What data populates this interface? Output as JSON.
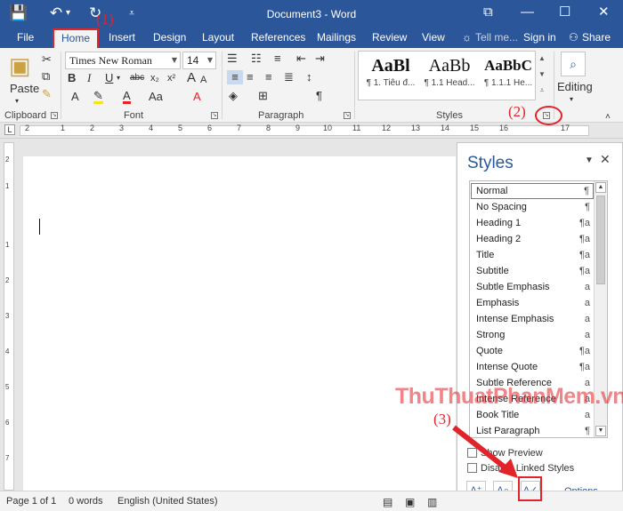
{
  "window": {
    "title": "Document3 - Word",
    "qat": {
      "save_icon": "💾",
      "undo_icon": "↶",
      "redo_icon": "↻",
      "customize_icon": "⩾"
    },
    "controls": {
      "restore_icon": "⧉",
      "minimize_icon": "—",
      "maximize_icon": "☐",
      "close_icon": "✕"
    }
  },
  "tabs": {
    "file": "File",
    "home": "Home",
    "insert": "Insert",
    "design": "Design",
    "layout": "Layout",
    "references": "References",
    "mailings": "Mailings",
    "review": "Review",
    "view": "View",
    "tell_me": "Tell me...",
    "signin": "Sign in",
    "share": "Share"
  },
  "ribbon": {
    "clipboard": {
      "label": "Clipboard",
      "paste": "Paste"
    },
    "font": {
      "label": "Font",
      "family": "Times New Roman",
      "size": "14",
      "bold": "B",
      "italic": "I",
      "underline": "U",
      "strike": "abc",
      "subscript": "x₂",
      "superscript": "x²",
      "grow": "A",
      "shrink": "A",
      "case": "Aa",
      "clear": "A"
    },
    "paragraph": {
      "label": "Paragraph",
      "pilcrow": "¶"
    },
    "styles": {
      "label": "Styles",
      "gallery": [
        {
          "preview": "AaBl",
          "name": "¶ 1. Tiêu đ..."
        },
        {
          "preview": "AaBb",
          "name": "¶ 1.1 Head..."
        },
        {
          "preview": "AaBbC",
          "name": "¶ 1.1.1 He..."
        }
      ]
    },
    "editing": {
      "label": "Editing"
    }
  },
  "annotations": {
    "step1": "(1)",
    "step2": "(2)",
    "step3": "(3)"
  },
  "ruler": {
    "numbers": [
      "2",
      "1",
      "1",
      "2",
      "3",
      "4",
      "5",
      "6",
      "7",
      "8",
      "9",
      "10",
      "11",
      "12",
      "13",
      "14",
      "15",
      "16",
      "17"
    ],
    "vnumbers": [
      "2",
      "1",
      "1",
      "2",
      "3",
      "4",
      "5",
      "6",
      "7"
    ]
  },
  "styles_pane": {
    "title": "Styles",
    "items": [
      {
        "name": "Normal",
        "mark": "¶"
      },
      {
        "name": "No Spacing",
        "mark": "¶"
      },
      {
        "name": "Heading 1",
        "mark": "¶a"
      },
      {
        "name": "Heading 2",
        "mark": "¶a"
      },
      {
        "name": "Title",
        "mark": "¶a"
      },
      {
        "name": "Subtitle",
        "mark": "¶a"
      },
      {
        "name": "Subtle Emphasis",
        "mark": "a"
      },
      {
        "name": "Emphasis",
        "mark": "a"
      },
      {
        "name": "Intense Emphasis",
        "mark": "a"
      },
      {
        "name": "Strong",
        "mark": "a"
      },
      {
        "name": "Quote",
        "mark": "¶a"
      },
      {
        "name": "Intense Quote",
        "mark": "¶a"
      },
      {
        "name": "Subtle Reference",
        "mark": "a"
      },
      {
        "name": "Intense Reference",
        "mark": "a"
      },
      {
        "name": "Book Title",
        "mark": "a"
      },
      {
        "name": "List Paragraph",
        "mark": "¶"
      }
    ],
    "show_preview": "Show Preview",
    "disable_linked": "Disable Linked Styles",
    "options": "Options..."
  },
  "watermark": "ThuThuatPhanMem.vn",
  "status": {
    "page": "Page 1 of 1",
    "words": "0 words",
    "language": "English (United States)"
  }
}
